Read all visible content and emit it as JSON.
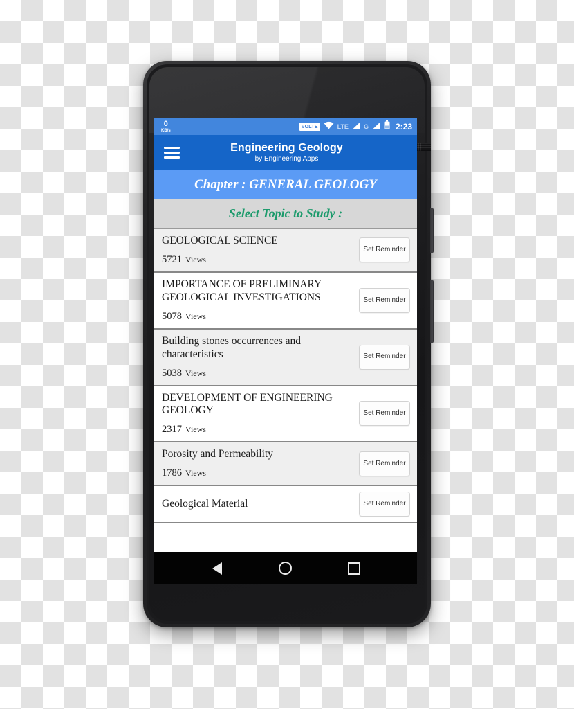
{
  "status_bar": {
    "net_speed_value": "0",
    "net_speed_unit": "KB/s",
    "volte_badge": "VOLTE",
    "wifi_icon": "wifi-icon",
    "lte_label": "LTE",
    "sim1_signal_icon": "signal-bars-icon",
    "gprs_label": "G",
    "sim2_signal_icon": "signal-bars-icon",
    "battery_icon": "battery-icon",
    "clock": "2:23"
  },
  "app_bar": {
    "menu_icon": "hamburger-menu-icon",
    "title": "Engineering Geology",
    "subtitle": "by Engineering Apps"
  },
  "chapter_banner": {
    "text": "Chapter : GENERAL GEOLOGY"
  },
  "select_topic": {
    "text": "Select Topic to Study :"
  },
  "topics": [
    {
      "title": "GEOLOGICAL SCIENCE",
      "views_count": "5721",
      "views_label": "Views",
      "reminder_button": "Set Reminder"
    },
    {
      "title": "IMPORTANCE OF PRELIMINARY GEOLOGICAL INVESTIGATIONS",
      "views_count": "5078",
      "views_label": "Views",
      "reminder_button": "Set Reminder"
    },
    {
      "title": "Building stones  occurrences and characteristics",
      "views_count": "5038",
      "views_label": "Views",
      "reminder_button": "Set Reminder"
    },
    {
      "title": "DEVELOPMENT OF ENGINEERING GEOLOGY",
      "views_count": "2317",
      "views_label": "Views",
      "reminder_button": "Set Reminder"
    },
    {
      "title": "Porosity and Permeability",
      "views_count": "1786",
      "views_label": "Views",
      "reminder_button": "Set Reminder"
    },
    {
      "title": "Geological Material",
      "views_count": "",
      "views_label": "",
      "reminder_button": "Set Reminder"
    }
  ],
  "nav_bar": {
    "back_icon": "back-triangle-icon",
    "home_icon": "home-circle-icon",
    "recents_icon": "recents-square-icon"
  },
  "colors": {
    "app_bar_blue": "#1565c8",
    "status_bar_blue": "#4286dd",
    "chapter_banner_blue": "#5b9bf5",
    "select_topic_bg": "#d7d7d7",
    "select_topic_green": "#1b9a6b",
    "row_shaded": "#efefef"
  }
}
